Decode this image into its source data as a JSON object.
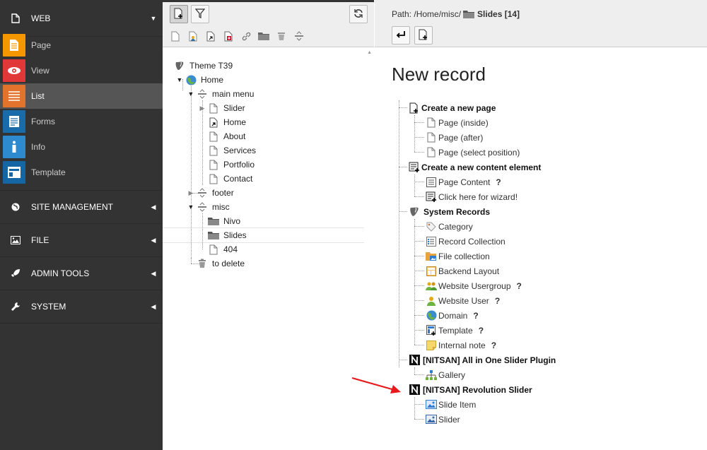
{
  "modmenu": {
    "web": {
      "label": "WEB"
    },
    "modules": [
      {
        "label": "Page",
        "color": "#f49700",
        "icon": "page-icon"
      },
      {
        "label": "View",
        "color": "#e03838",
        "icon": "eye-icon"
      },
      {
        "label": "List",
        "color": "#e2732d",
        "icon": "list-icon"
      },
      {
        "label": "Forms",
        "color": "#1a6baa",
        "icon": "forms-icon"
      },
      {
        "label": "Info",
        "color": "#2e8ace",
        "icon": "info-icon"
      },
      {
        "label": "Template",
        "color": "#1566a5",
        "icon": "template-icon"
      }
    ],
    "groups": [
      {
        "label": "SITE MANAGEMENT",
        "icon": "globe-icon"
      },
      {
        "label": "FILE",
        "icon": "image-icon"
      },
      {
        "label": "ADMIN TOOLS",
        "icon": "rocket-icon"
      },
      {
        "label": "SYSTEM",
        "icon": "wrench-icon"
      }
    ]
  },
  "tree": {
    "root": "Theme T39",
    "nodes": [
      {
        "label": "Home",
        "icon": "globe-icon"
      },
      {
        "label": "main menu",
        "icon": "separator-icon"
      },
      {
        "label": "Slider",
        "icon": "page-icon"
      },
      {
        "label": "Home",
        "icon": "shortcut-page-icon"
      },
      {
        "label": "About",
        "icon": "page-icon"
      },
      {
        "label": "Services",
        "icon": "page-icon"
      },
      {
        "label": "Portfolio",
        "icon": "page-icon"
      },
      {
        "label": "Contact",
        "icon": "page-icon"
      },
      {
        "label": "footer",
        "icon": "separator-icon"
      },
      {
        "label": "misc",
        "icon": "separator-icon"
      },
      {
        "label": "Nivo",
        "icon": "folder-icon"
      },
      {
        "label": "Slides",
        "icon": "folder-icon"
      },
      {
        "label": "404",
        "icon": "page-icon"
      },
      {
        "label": "to delete",
        "icon": "trash-icon"
      }
    ]
  },
  "header": {
    "path_prefix": "Path: /Home/misc/",
    "path_current": "Slides [14]"
  },
  "main": {
    "title": "New record",
    "sections": [
      {
        "label": "Create a new page",
        "icon": "new-page-icon",
        "items": [
          {
            "label": "Page (inside)",
            "icon": "page-icon",
            "help": ""
          },
          {
            "label": "Page (after)",
            "icon": "page-icon",
            "help": ""
          },
          {
            "label": "Page (select position)",
            "icon": "page-icon",
            "help": ""
          }
        ]
      },
      {
        "label": "Create a new content element",
        "icon": "new-content-icon",
        "items": [
          {
            "label": "Page Content",
            "icon": "content-icon",
            "help": "?"
          },
          {
            "label": "Click here for wizard!",
            "icon": "wizard-icon",
            "help": ""
          }
        ]
      },
      {
        "label": "System Records",
        "icon": "typo3-icon",
        "items": [
          {
            "label": "Category",
            "icon": "tag-icon",
            "help": ""
          },
          {
            "label": "Record Collection",
            "icon": "collection-icon",
            "help": ""
          },
          {
            "label": "File collection",
            "icon": "file-collection-icon",
            "help": ""
          },
          {
            "label": "Backend Layout",
            "icon": "layout-icon",
            "help": ""
          },
          {
            "label": "Website Usergroup",
            "icon": "usergroup-icon",
            "help": "?"
          },
          {
            "label": "Website User",
            "icon": "user-icon",
            "help": "?"
          },
          {
            "label": "Domain",
            "icon": "globe-icon",
            "help": "?"
          },
          {
            "label": "Template",
            "icon": "template-icon",
            "help": "?"
          },
          {
            "label": "Internal note",
            "icon": "note-icon",
            "help": "?"
          }
        ]
      },
      {
        "label": "[NITSAN] All in One Slider Plugin",
        "icon": "nitsan-icon",
        "items": [
          {
            "label": "Gallery",
            "icon": "sitemap-icon",
            "help": ""
          }
        ]
      },
      {
        "label": "[NITSAN] Revolution Slider",
        "icon": "nitsan-icon",
        "items": [
          {
            "label": "Slide Item",
            "icon": "image-icon",
            "help": ""
          },
          {
            "label": "Slider",
            "icon": "slider-image-icon",
            "help": ""
          }
        ]
      }
    ]
  }
}
